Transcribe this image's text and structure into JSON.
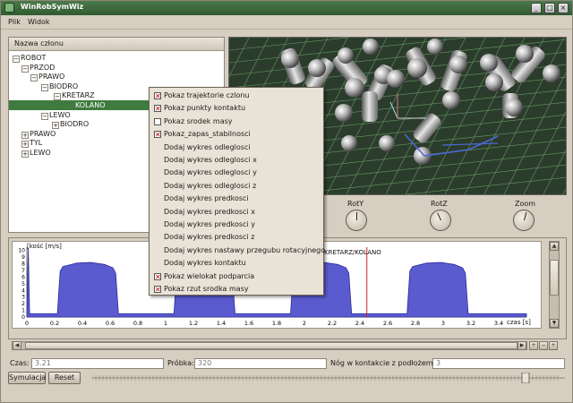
{
  "window": {
    "title": "WinRobSymWiz",
    "controls": [
      "_",
      "□",
      "×"
    ]
  },
  "menubar": {
    "items": [
      "Plik",
      "Widok"
    ]
  },
  "tree": {
    "header": "Nazwa członu",
    "rows": [
      {
        "label": "ROBOT",
        "prefix": "⊟"
      },
      {
        "label": "PRZOD",
        "prefix": "⊟"
      },
      {
        "label": "PRAWO",
        "prefix": "⊟"
      },
      {
        "label": "BIODRO",
        "prefix": "⊟"
      },
      {
        "label": "KRETARZ",
        "prefix": "⊟"
      },
      {
        "label": "KOLANO",
        "prefix": ""
      },
      {
        "label": "LEWO",
        "prefix": "⊟"
      },
      {
        "label": "BIODRO",
        "prefix": "⊞"
      },
      {
        "label": "PRAWO",
        "prefix": "⊞"
      },
      {
        "label": "TYL",
        "prefix": "⊞"
      },
      {
        "label": "LEWO",
        "prefix": "⊞"
      }
    ],
    "selected_index": 5
  },
  "knobs": [
    "RotY",
    "RotZ",
    "Zoom"
  ],
  "context_menu": {
    "items": [
      {
        "label": "Pokaz trajektorie czlonu",
        "checkbox": true,
        "checked": true
      },
      {
        "label": "Pokaz punkty kontaktu",
        "checkbox": true,
        "checked": true
      },
      {
        "label": "Pokaz srodek masy",
        "checkbox": true,
        "checked": false
      },
      {
        "label": "Pokaz_zapas_stabilnosci",
        "checkbox": true,
        "checked": true
      },
      {
        "label": "Dodaj wykres odleglosci",
        "checkbox": false
      },
      {
        "label": "Dodaj wykres odleglosci x",
        "checkbox": false
      },
      {
        "label": "Dodaj wykres odleglosci y",
        "checkbox": false
      },
      {
        "label": "Dodaj wykres odleglosci z",
        "checkbox": false
      },
      {
        "label": "Dodaj wykres predkosci",
        "checkbox": false
      },
      {
        "label": "Dodaj wykres predkosci x",
        "checkbox": false
      },
      {
        "label": "Dodaj wykres predkosci y",
        "checkbox": false
      },
      {
        "label": "Dodaj wykres predkosci z",
        "checkbox": false
      },
      {
        "label": "Dodaj wykres nastawy przegubu rotacyjnego",
        "checkbox": false
      },
      {
        "label": "Dodaj wykres kontaktu",
        "checkbox": false
      },
      {
        "label": "Pokaz wielokat podparcia",
        "checkbox": true,
        "checked": true
      },
      {
        "label": "Pokaz rzut srodka masy",
        "checkbox": true,
        "checked": true
      }
    ]
  },
  "plot": {
    "ylabel": "[kość [m/s]",
    "annotation": "KRETARZ/KOLANO",
    "xlabel": "czas [s]"
  },
  "chart_data": {
    "type": "area",
    "title": "",
    "ylabel": "[kość [m/s]",
    "xlabel": "czas [s]",
    "xlim": [
      0,
      3.6
    ],
    "ylim": [
      0,
      10.5
    ],
    "x_ticks": [
      0,
      0.2,
      0.4,
      0.6,
      0.8,
      1,
      1.2,
      1.4,
      1.6,
      1.8,
      2,
      2.2,
      2.4,
      2.6,
      2.8,
      3,
      3.2,
      3.4
    ],
    "y_ticks": [
      0,
      1,
      2,
      3,
      4,
      5,
      6,
      7,
      8,
      9,
      10
    ],
    "series": [
      {
        "x": [
          0,
          0.01,
          0.02,
          0.03,
          0.06,
          0.22,
          0.24,
          0.26,
          0.36,
          0.46,
          0.56,
          0.62,
          0.64,
          0.66,
          0.9,
          1.06,
          1.08,
          1.1,
          1.2,
          1.3,
          1.4,
          1.46,
          1.48,
          1.5,
          1.74,
          1.9,
          1.92,
          1.94,
          2.04,
          2.14,
          2.24,
          2.3,
          2.32,
          2.34,
          2.58,
          2.74,
          2.76,
          2.78,
          2.88,
          2.98,
          3.08,
          3.14,
          3.16,
          3.18,
          3.6
        ],
        "y": [
          0.5,
          10.4,
          0.5,
          0.5,
          0.5,
          0.5,
          6.9,
          7.6,
          8.1,
          8.2,
          7.9,
          7.4,
          6.6,
          0.5,
          0.5,
          0.5,
          6.9,
          7.6,
          8.1,
          8.2,
          7.9,
          7.4,
          6.6,
          0.5,
          0.5,
          0.5,
          6.9,
          7.6,
          8.1,
          8.2,
          7.9,
          7.4,
          6.6,
          0.5,
          0.5,
          0.5,
          6.9,
          7.6,
          8.1,
          8.2,
          7.9,
          7.4,
          6.6,
          0.5,
          0.5
        ]
      }
    ],
    "cursor_x": 2.45,
    "colors": {
      "fill": "#5b5bd0",
      "stroke": "#2a2a9a",
      "cursor": "#d02020"
    }
  },
  "status": {
    "time_label": "Czas:",
    "time_value": "3.21",
    "sample_label": "Próbka:",
    "sample_value": "320",
    "contact_label": "Nóg w kontakcie z podłożem:",
    "contact_value": "3",
    "simulate_button": "Symulacja",
    "reset_button": "Reset"
  },
  "colors": {
    "title_bar": "#2f5a2f",
    "selection": "#3f7a3f",
    "ground": "#2c3c2c",
    "grid": "#6ea86e"
  }
}
